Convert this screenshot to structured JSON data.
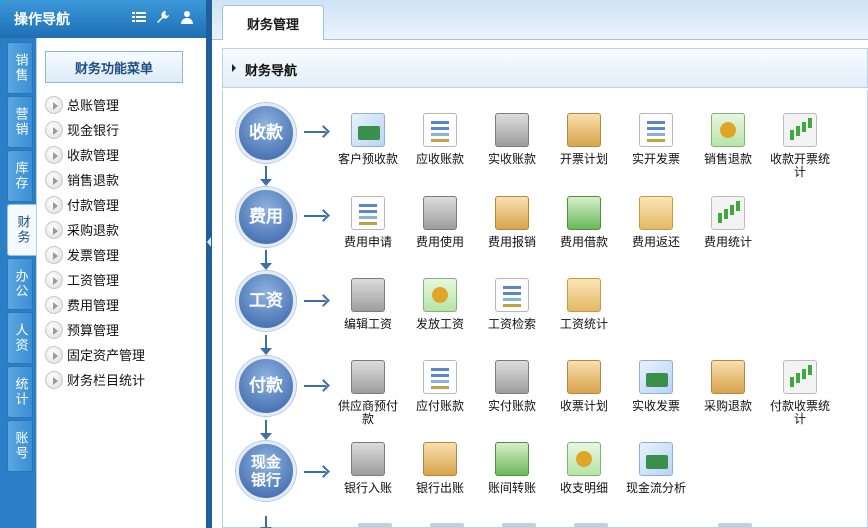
{
  "nav": {
    "title": "操作导航",
    "tool_icons": [
      "list-icon",
      "wrench-icon",
      "user-icon"
    ],
    "vertical_tabs": [
      "销售",
      "营销",
      "库存",
      "财务",
      "办公",
      "人资",
      "统计",
      "账号"
    ],
    "active_tab": "财务",
    "menu_header": "财务功能菜单",
    "menu_items": [
      "总账管理",
      "现金银行",
      "收款管理",
      "销售退款",
      "付款管理",
      "采购退款",
      "发票管理",
      "工资管理",
      "费用管理",
      "预算管理",
      "固定资产管理",
      "财务栏目统计"
    ]
  },
  "main": {
    "tab_label": "财务管理",
    "section_title": "财务导航",
    "stages": [
      {
        "label": "收款",
        "items": [
          {
            "label": "客户预收款",
            "icon": "credit-card-icon"
          },
          {
            "label": "应收账款",
            "icon": "receivable-doc-icon"
          },
          {
            "label": "实收账款",
            "icon": "pos-terminal-icon"
          },
          {
            "label": "开票计划",
            "icon": "clipboard-icon"
          },
          {
            "label": "实开发票",
            "icon": "printer-check-icon"
          },
          {
            "label": "销售退款",
            "icon": "cash-refund-icon"
          },
          {
            "label": "收款开票统计",
            "icon": "bar-chart-icon"
          }
        ]
      },
      {
        "label": "费用",
        "items": [
          {
            "label": "费用申请",
            "icon": "form-edit-icon"
          },
          {
            "label": "费用使用",
            "icon": "card-reader-icon"
          },
          {
            "label": "费用报销",
            "icon": "ledger-book-icon"
          },
          {
            "label": "费用借款",
            "icon": "banknote-icon"
          },
          {
            "label": "费用返还",
            "icon": "return-box-icon"
          },
          {
            "label": "费用统计",
            "icon": "stats-chart-icon"
          }
        ]
      },
      {
        "label": "工资",
        "items": [
          {
            "label": "编辑工资",
            "icon": "calculator-icon"
          },
          {
            "label": "发放工资",
            "icon": "envelope-money-icon"
          },
          {
            "label": "工资检索",
            "icon": "magnifier-doc-icon"
          },
          {
            "label": "工资统计",
            "icon": "folder-chart-icon"
          }
        ]
      },
      {
        "label": "付款",
        "items": [
          {
            "label": "供应商预付款",
            "icon": "database-check-icon"
          },
          {
            "label": "应付账款",
            "icon": "payable-doc-icon"
          },
          {
            "label": "实付账款",
            "icon": "calculator-keypad-icon"
          },
          {
            "label": "收票计划",
            "icon": "checklist-icon"
          },
          {
            "label": "实收发票",
            "icon": "ticket-icon"
          },
          {
            "label": "采购退款",
            "icon": "wallet-icon"
          },
          {
            "label": "付款收票统计",
            "icon": "report-chart-icon"
          }
        ]
      },
      {
        "label": "现金银行",
        "items": [
          {
            "label": "银行入账",
            "icon": "truck-server-icon"
          },
          {
            "label": "银行出账",
            "icon": "bank-house-icon"
          },
          {
            "label": "账间转账",
            "icon": "transfer-down-icon"
          },
          {
            "label": "收支明细",
            "icon": "money-detail-icon"
          },
          {
            "label": "现金流分析",
            "icon": "pie-chart-icon"
          }
        ]
      }
    ]
  },
  "colors": {
    "header_blue": "#1e6fb3",
    "stage_blue": "#4f79b8",
    "arrow_blue": "#3b6fa8",
    "panel_border": "#b7d2ea"
  }
}
